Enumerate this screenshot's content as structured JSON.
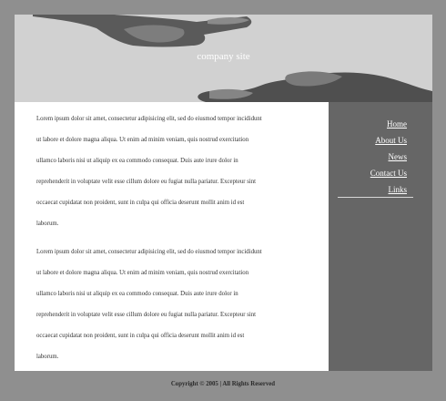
{
  "header": {
    "site_title": "company site"
  },
  "content": {
    "paragraphs": [
      {
        "lines": [
          "Lorem ipsum dolor sit amet, consectetur adipisicing elit, sed do eiusmod tempor incididunt",
          "ut labore et dolore magna aliqua. Ut enim ad minim veniam, quis nostrud exercitation",
          "ullamco laboris nisi ut aliquip ex ea commodo consequat. Duis aute irure dolor in",
          "reprehenderit in voluptate velit esse cillum dolore eu fugiat nulla pariatur. Excepteur sint",
          "occaecat cupidatat non proident, sunt in culpa qui officia deserunt mollit anim id est",
          "laborum."
        ]
      },
      {
        "lines": [
          "Lorem ipsum dolor sit amet, consectetur adipisicing elit, sed do eiusmod tempor incididunt",
          "ut labore et dolore magna aliqua. Ut enim ad minim veniam, quis nostrud exercitation",
          "ullamco laboris nisi ut aliquip ex ea commodo consequat. Duis aute irure dolor in",
          "reprehenderit in voluptate velit esse cillum dolore eu fugiat nulla pariatur. Excepteur sint",
          "occaecat cupidatat non proident, sunt in culpa qui officia deserunt mollit anim id est",
          "laborum."
        ]
      }
    ]
  },
  "nav": {
    "items": [
      {
        "label": "Home"
      },
      {
        "label": "About Us"
      },
      {
        "label": "News"
      },
      {
        "label": "Contact Us"
      },
      {
        "label": "Links"
      }
    ]
  },
  "footer": {
    "copyright": "Copyright © 2005 | All Rights Reserved"
  },
  "colors": {
    "page_background": "#8f8f8f",
    "banner": "#d1d1d1",
    "sidebar": "#666666",
    "content": "#ffffff"
  }
}
